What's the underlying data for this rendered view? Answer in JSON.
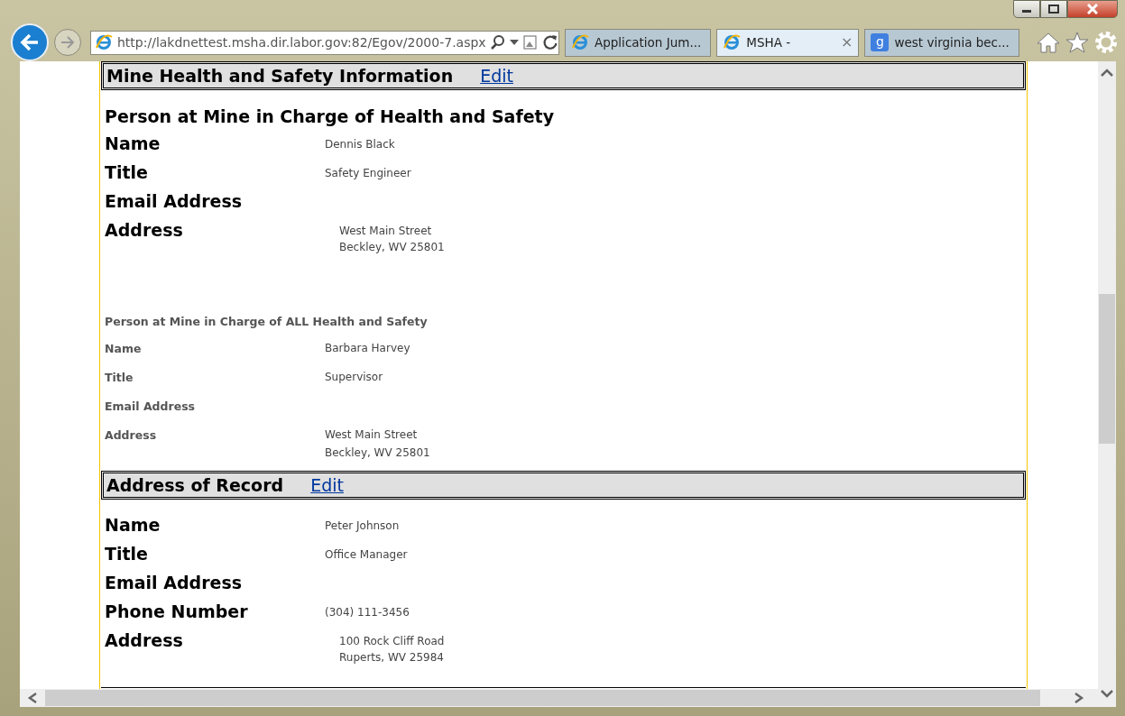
{
  "browser": {
    "url": "http://lakdnettest.msha.dir.labor.gov:82/Egov/2000-7.aspx",
    "tabs": [
      {
        "title": "Application Jum...",
        "selected": false
      },
      {
        "title": "MSHA -",
        "selected": true,
        "close": "×"
      },
      {
        "title": "west virginia bec...",
        "selected": false,
        "favicon_letter": "g"
      }
    ]
  },
  "blocks": [
    {
      "kind": "section_header",
      "title": "Mine Health and Safety Information",
      "link": "Edit"
    },
    {
      "kind": "large_group",
      "heading": "Person at Mine in Charge of Health and Safety",
      "fields": [
        {
          "label": "Name",
          "lines": [
            "Dennis Black"
          ]
        },
        {
          "label": "Title",
          "lines": [
            "Safety Engineer"
          ]
        },
        {
          "label": "Email Address"
        },
        {
          "label": "Address",
          "lines": [
            "West Main Street",
            "Beckley, WV 25801"
          ]
        }
      ]
    },
    {
      "kind": "small_group",
      "heading": "Person at Mine in Charge of ALL Health and Safety",
      "fields": [
        {
          "label": "Name",
          "lines": [
            "Barbara Harvey"
          ]
        },
        {
          "label": "Title",
          "lines": [
            "Supervisor"
          ]
        },
        {
          "label": "Email Address"
        },
        {
          "label": "Address",
          "lines": [
            "West Main Street",
            "Beckley, WV 25801"
          ]
        }
      ]
    },
    {
      "kind": "section_header",
      "title": "Address of Record",
      "link": "Edit"
    },
    {
      "kind": "large_group",
      "fields": [
        {
          "label": "Name",
          "lines": [
            "Peter Johnson"
          ]
        },
        {
          "label": "Title",
          "lines": [
            "Office Manager"
          ]
        },
        {
          "label": "Email Address"
        },
        {
          "label": "Phone Number",
          "lines": [
            "(304) 111-3456"
          ]
        },
        {
          "label": "Address",
          "lines": [
            "100 Rock Cliff Road",
            "Ruperts, WV 25984"
          ]
        }
      ]
    }
  ]
}
